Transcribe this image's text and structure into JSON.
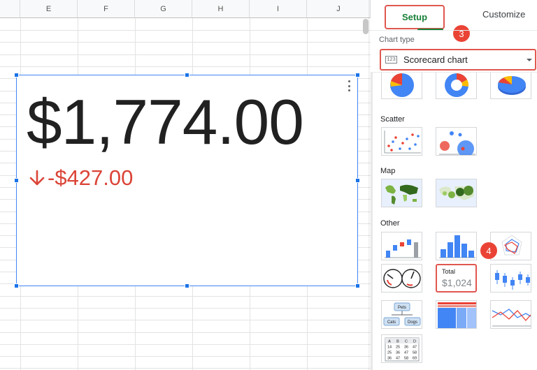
{
  "sheet": {
    "columns": [
      "E",
      "F",
      "G",
      "H",
      "I",
      "J"
    ]
  },
  "scorecard": {
    "key_value": "$1,774.00",
    "delta": "-$427.00",
    "delta_color": "#db4437"
  },
  "panel": {
    "tabs": [
      {
        "label": "Setup",
        "active": true
      },
      {
        "label": "Customize",
        "active": false
      }
    ],
    "chart_type_label": "Chart type",
    "chart_type_icon_text": "123",
    "chart_type_value": "Scorecard chart",
    "sections": [
      {
        "title": "Scatter"
      },
      {
        "title": "Map"
      },
      {
        "title": "Other"
      }
    ],
    "scorecard_thumb": {
      "title": "Total",
      "value": "$1,024"
    },
    "org_thumb": {
      "top": "Pets",
      "left": "Cats",
      "right": "Dogs"
    },
    "table_thumb": {
      "rows": [
        [
          "A",
          "B",
          "C",
          "D"
        ],
        [
          "14",
          "25",
          "36",
          "47"
        ],
        [
          "25",
          "36",
          "47",
          "58"
        ],
        [
          "36",
          "47",
          "58",
          "69"
        ]
      ]
    }
  },
  "annotations": {
    "step3": "3",
    "step4": "4",
    "highlight_color": "#e0574f",
    "accent_green": "#188038"
  }
}
